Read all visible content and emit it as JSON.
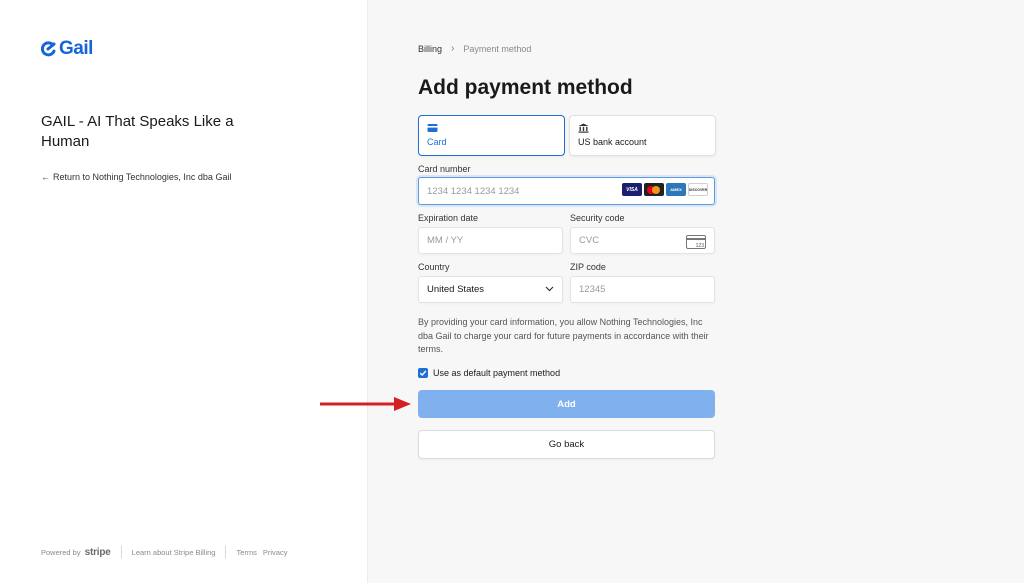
{
  "left_panel": {
    "logo_text": "Gail",
    "product_title": "GAIL - AI That Speaks Like a Human",
    "return_link": "Return to Nothing Technologies, Inc dba Gail",
    "footer": {
      "powered_by": "Powered by",
      "stripe": "stripe",
      "learn_link": "Learn about Stripe Billing",
      "terms_link": "Terms",
      "privacy_link": "Privacy"
    }
  },
  "breadcrumb": {
    "billing": "Billing",
    "current": "Payment method"
  },
  "heading": "Add payment method",
  "tabs": [
    {
      "label": "Card",
      "icon": "credit-card-icon",
      "active": true
    },
    {
      "label": "US bank account",
      "icon": "bank-icon",
      "active": false
    }
  ],
  "form": {
    "card_number": {
      "label": "Card number",
      "placeholder": "1234 1234 1234 1234",
      "brands": [
        "VISA",
        "mastercard",
        "AMEX",
        "DISCOVER"
      ]
    },
    "expiration": {
      "label": "Expiration date",
      "placeholder": "MM / YY"
    },
    "security": {
      "label": "Security code",
      "placeholder": "CVC",
      "icon_text": "123"
    },
    "country": {
      "label": "Country",
      "value": "United States"
    },
    "zip": {
      "label": "ZIP code",
      "placeholder": "12345"
    }
  },
  "terms_text": "By providing your card information, you allow Nothing Technologies, Inc dba Gail to charge your card for future payments in accordance with their terms.",
  "default_checkbox": {
    "label": "Use as default payment method",
    "checked": true
  },
  "buttons": {
    "add": "Add",
    "go_back": "Go back"
  },
  "colors": {
    "brand_blue": "#1565d8",
    "accent": "#1f6ed4",
    "add_button": "#80b1ee",
    "annotation_arrow": "#d42020"
  }
}
